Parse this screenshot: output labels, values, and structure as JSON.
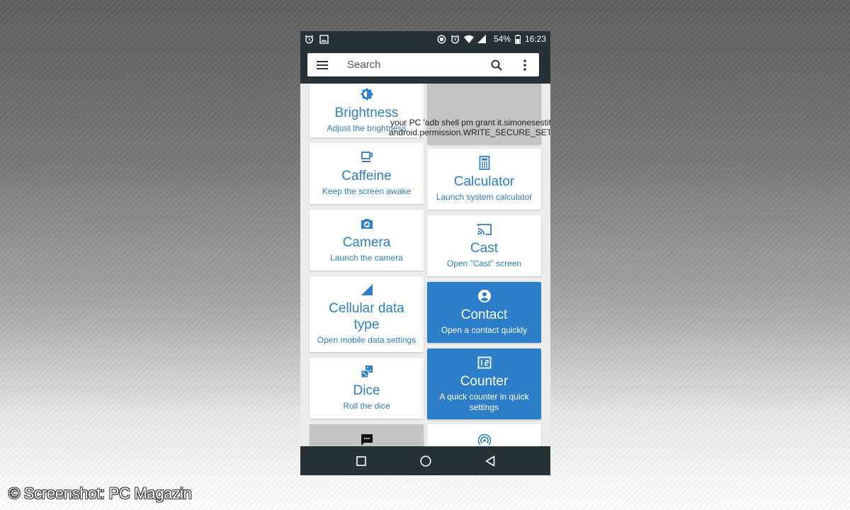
{
  "status_bar": {
    "left_icons": [
      "alarm-icon",
      "image-icon"
    ],
    "right_icons": [
      "record-icon",
      "alarm-icon",
      "wifi-icon",
      "signal-icon"
    ],
    "battery": "54%",
    "time": "16:23"
  },
  "toolbar": {
    "menu_icon": "hamburger-menu-icon",
    "search_placeholder": "Search",
    "search_icon": "search-icon",
    "more_icon": "more-vert-icon"
  },
  "tiles": {
    "brightness": {
      "title": "Brightness",
      "subtitle": "Adjust the brightness",
      "icon": "brightness-icon"
    },
    "caffeine": {
      "title": "Caffeine",
      "subtitle": "Keep the screen awake",
      "icon": "coffee-cup-icon"
    },
    "camera": {
      "title": "Camera",
      "subtitle": "Launch the camera",
      "icon": "camera-icon"
    },
    "cellular": {
      "title": "Cellular data type",
      "subtitle": "Open mobile data settings",
      "icon": "signal-triangle-icon"
    },
    "dice": {
      "title": "Dice",
      "subtitle": "Roll the dice",
      "icon": "dice-icon"
    },
    "secure_settings": {
      "message": "your PC 'adb shell pm grant it.simonesestito.ntiles android.permission.WRITE_SECURE_SETTINGS'"
    },
    "calculator": {
      "title": "Calculator",
      "subtitle": "Launch system calculator",
      "icon": "calculator-icon"
    },
    "cast": {
      "title": "Cast",
      "subtitle": "Open \"Cast\" screen",
      "icon": "cast-icon"
    },
    "contact": {
      "title": "Contact",
      "subtitle": "Open a contact quickly",
      "icon": "account-circle-icon"
    },
    "counter": {
      "title": "Counter",
      "subtitle": "A quick counter in quick settings",
      "icon": "counter-icon"
    },
    "partial_left": {
      "icon": "message-icon"
    },
    "partial_right": {
      "icon": "hotspot-icon"
    }
  },
  "navbar": {
    "recents": "recents-square-icon",
    "home": "home-circle-icon",
    "back": "back-triangle-icon"
  },
  "credit": "© Screenshot: PC Magazin",
  "colors": {
    "accent": "#2e7ec9",
    "bar": "#263238",
    "disabled": "#c4c4c4"
  }
}
